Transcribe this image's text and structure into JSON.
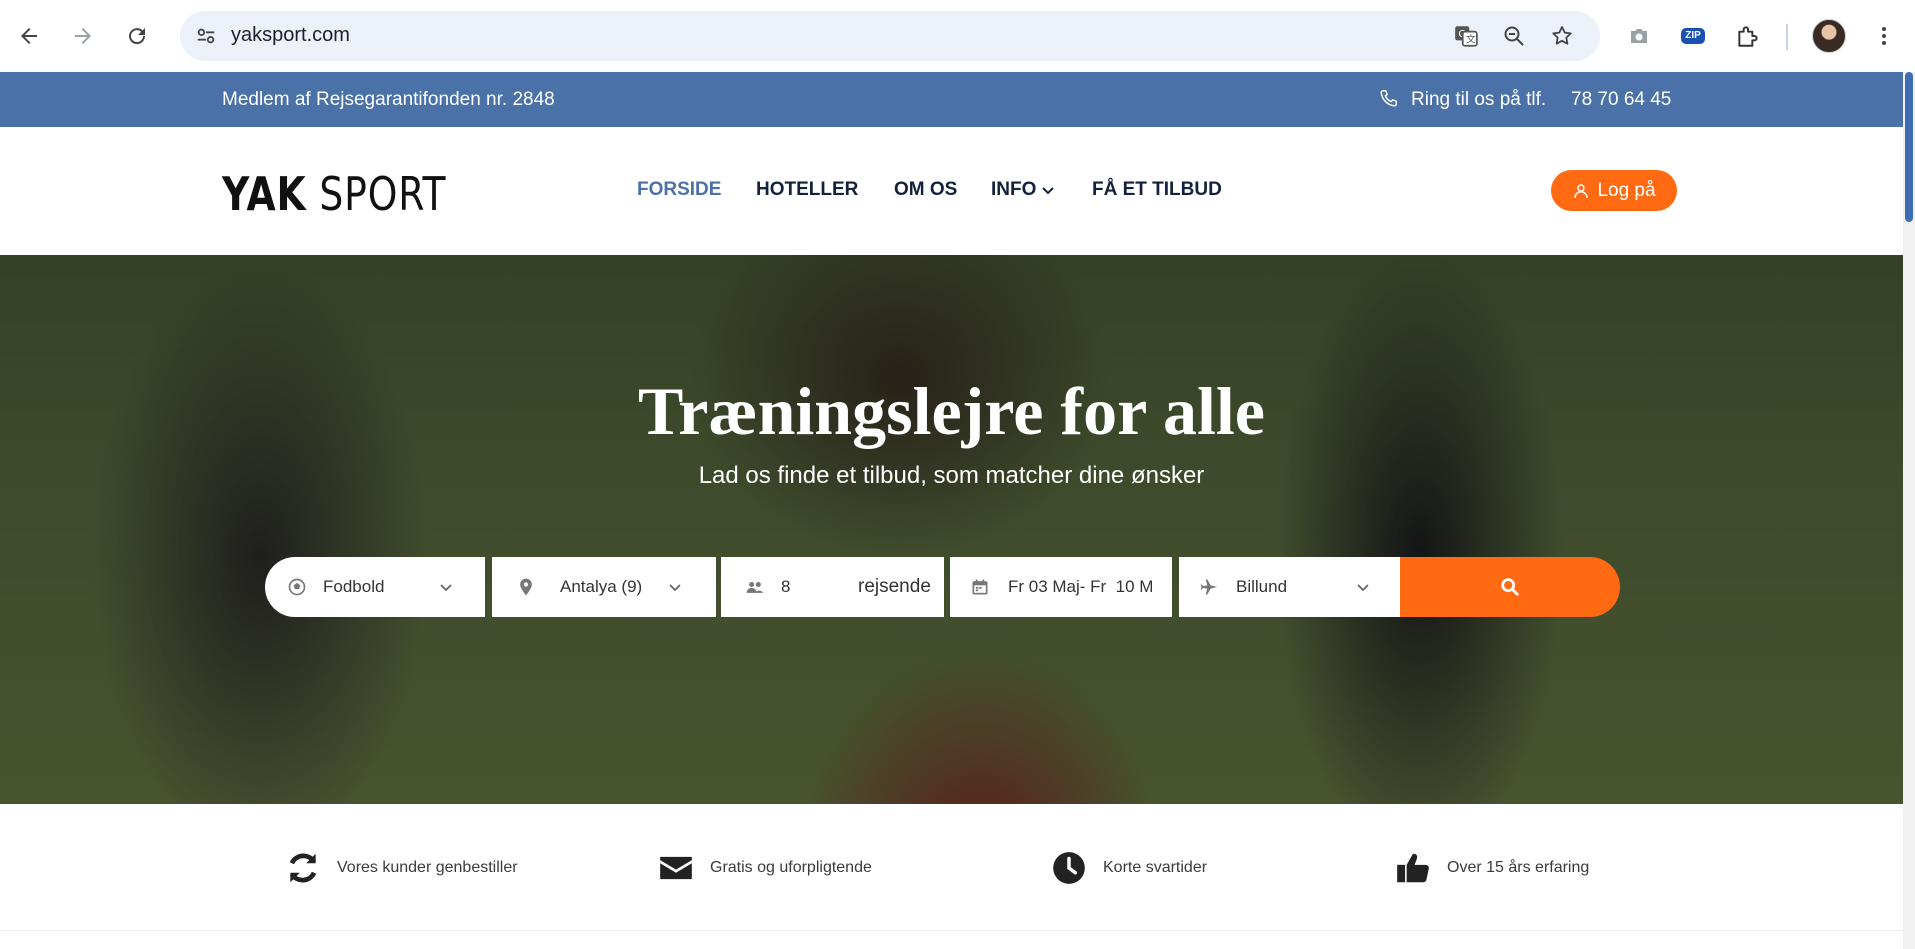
{
  "browser": {
    "url": "yaksport.com",
    "icons": [
      "back-icon",
      "forward-icon",
      "reload-icon",
      "site-info-icon",
      "translate-icon",
      "zoom-icon",
      "bookmark-star-icon",
      "camera-icon",
      "zip-extension-icon",
      "extensions-puzzle-icon",
      "profile-avatar",
      "more-menu-icon"
    ],
    "zip_label": "ZIP"
  },
  "topbar": {
    "member_text": "Medlem af Rejsegarantifonden nr. 2848",
    "phone_label": "Ring til os på tlf.",
    "phone_number": "78 70 64 45"
  },
  "header": {
    "logo_bold": "YAK",
    "logo_light": "SPORT",
    "nav": [
      {
        "label": "FORSIDE",
        "active": true
      },
      {
        "label": "HOTELLER"
      },
      {
        "label": "OM OS"
      },
      {
        "label": "INFO",
        "has_dropdown": true
      },
      {
        "label": "FÅ ET TILBUD"
      }
    ],
    "login_label": "Log på"
  },
  "hero": {
    "title": "Træningslejre for alle",
    "subtitle": "Lad os finde et tilbud, som matcher dine ønsker",
    "search": {
      "sport": "Fodbold",
      "destination": "Antalya (9)",
      "travellers_count": "8",
      "travellers_label": "rejsende",
      "dates": "Fr 03 Maj- Fr  10 M",
      "departure": "Billund"
    }
  },
  "features": [
    {
      "icon": "refresh-icon",
      "label": "Vores kunder genbestiller"
    },
    {
      "icon": "envelope-icon",
      "label": "Gratis og uforpligtende"
    },
    {
      "icon": "clock-icon",
      "label": "Korte svartider"
    },
    {
      "icon": "thumbs-up-icon",
      "label": "Over 15 års erfaring"
    }
  ],
  "colors": {
    "topbar_bg": "#4a71a8",
    "accent_orange": "#ff6a13",
    "nav_active": "#4a71a8",
    "nav_text": "#14213d"
  }
}
